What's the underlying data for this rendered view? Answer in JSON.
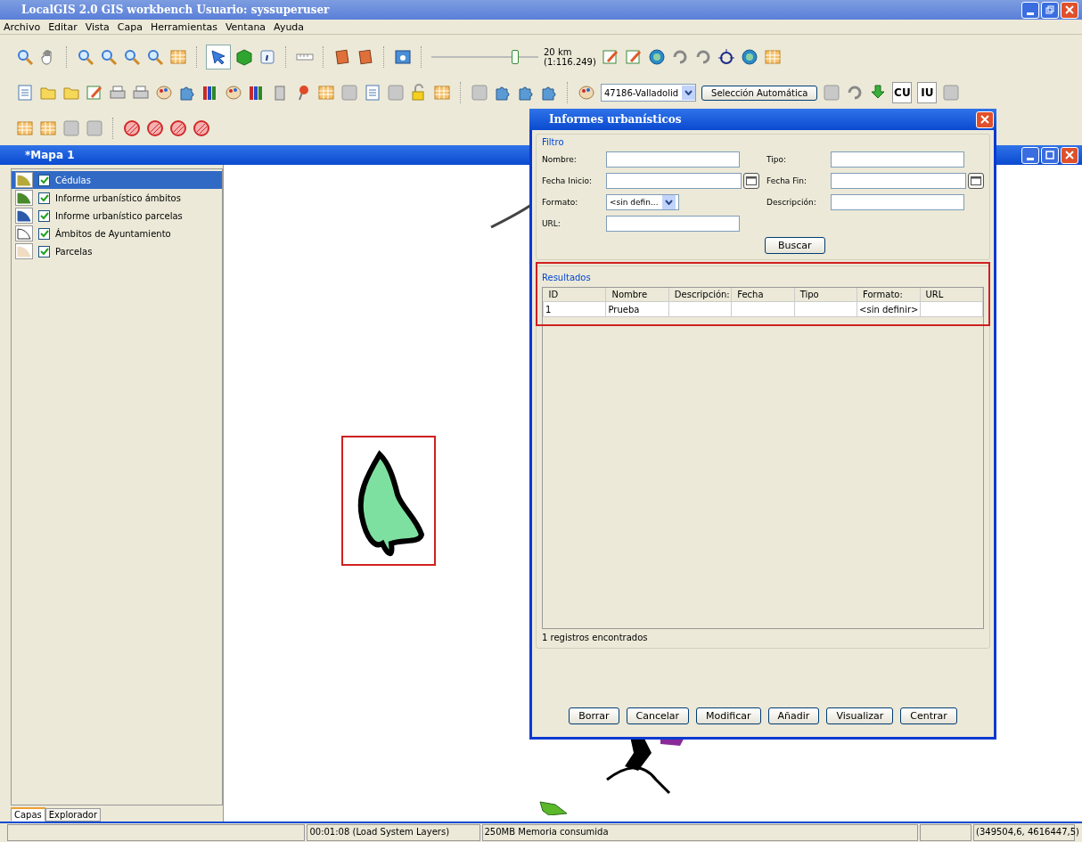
{
  "window": {
    "title": "LocalGIS 2.0 GIS workbench Usuario: syssuperuser"
  },
  "menu": [
    "Archivo",
    "Editar",
    "Vista",
    "Capa",
    "Herramientas",
    "Ventana",
    "Ayuda"
  ],
  "toolbar": {
    "zoom_slider": {
      "level": 0.78
    },
    "scale_km": "20 km",
    "scale_ratio": "(1:116.249)",
    "municipality": "47186-Valladolid",
    "auto_select_button": "Selección Automática",
    "cu_button": "CU",
    "iu_button": "IU"
  },
  "map_window": {
    "title": "*Mapa 1"
  },
  "layers": [
    {
      "name": "Cédulas",
      "checked": true,
      "selected": true,
      "color": "#b5a93a"
    },
    {
      "name": "Informe urbanístico ámbitos",
      "checked": true,
      "selected": false,
      "color": "#4a8a2a"
    },
    {
      "name": "Informe urbanístico parcelas",
      "checked": true,
      "selected": false,
      "color": "#2a5aa8"
    },
    {
      "name": "Ámbitos de Ayuntamiento",
      "checked": true,
      "selected": false,
      "color": "#ffffff"
    },
    {
      "name": "Parcelas",
      "checked": true,
      "selected": false,
      "color": "#f0dcc0"
    }
  ],
  "layer_tabs": [
    {
      "label": "Capas",
      "selected": true
    },
    {
      "label": "Explorador",
      "selected": false
    }
  ],
  "dialog": {
    "title": "Informes urbanísticos",
    "filter_title": "Filtro",
    "fields": [
      {
        "label": "Nombre:",
        "kind": "text"
      },
      {
        "label": "Tipo:",
        "kind": "text"
      },
      {
        "label": "Fecha Inicio:",
        "kind": "date"
      },
      {
        "label": "Fecha Fin:",
        "kind": "date"
      },
      {
        "label": "Formato:",
        "kind": "select",
        "value": "<sin defin..."
      },
      {
        "label": "Descripción:",
        "kind": "text"
      },
      {
        "label": "URL:",
        "kind": "text"
      }
    ],
    "search_button": "Buscar",
    "results_title": "Resultados",
    "columns": [
      "ID",
      "Nombre",
      "Descripción:",
      "Fecha",
      "Tipo",
      "Formato:",
      "URL"
    ],
    "rows": [
      [
        "1",
        "Prueba",
        null,
        null,
        null,
        "<sin definir>",
        null
      ]
    ],
    "count": "1 registros encontrados",
    "buttons": [
      "Borrar",
      "Cancelar",
      "Modificar",
      "Añadir",
      "Visualizar",
      "Centrar"
    ]
  },
  "status_bar": {
    "time": "00:01:08 (Load System Layers)",
    "memory": "250MB Memoria consumida",
    "coordinates": "(349504,6, 4616447,5)"
  }
}
